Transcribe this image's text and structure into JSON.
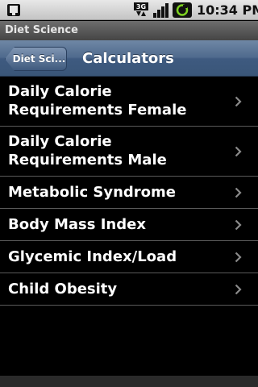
{
  "status_bar": {
    "time": "10:34 PM",
    "network_type": "3G",
    "icons": [
      "notification-icon",
      "3g-icon",
      "signal-icon",
      "battery-icon"
    ]
  },
  "app": {
    "title": "Diet Science"
  },
  "nav": {
    "back_label": "Diet Sci...",
    "title": "Calculators"
  },
  "list": {
    "items": [
      {
        "label": "Daily Calorie Requirements Female"
      },
      {
        "label": "Daily Calorie Requirements Male"
      },
      {
        "label": "Metabolic Syndrome"
      },
      {
        "label": "Body Mass Index"
      },
      {
        "label": "Glycemic Index/Load"
      },
      {
        "label": "Child Obesity"
      }
    ]
  },
  "colors": {
    "nav_background": "#4f6a8d",
    "list_background": "#000000",
    "list_text": "#ffffff",
    "divider": "#5a5a5a"
  }
}
